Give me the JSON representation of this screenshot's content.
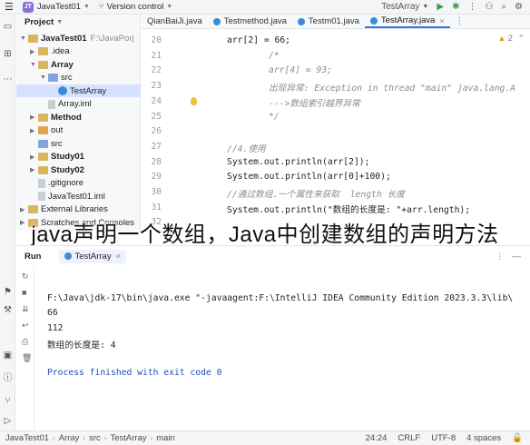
{
  "titlebar": {
    "project_badge": "JT",
    "project_name": "JavaTest01",
    "vcs_label": "Version control",
    "run_config": "TestArray"
  },
  "project_panel": {
    "title": "Project",
    "tree": [
      {
        "label": "JavaTest01",
        "suffix": "F:\\JavaPorj",
        "type": "folder",
        "depth": 0,
        "expanded": true
      },
      {
        "label": ".idea",
        "type": "folder",
        "depth": 1,
        "expanded": false
      },
      {
        "label": "Array",
        "type": "folder",
        "depth": 1,
        "expanded": true
      },
      {
        "label": "src",
        "type": "folder-blue",
        "depth": 2,
        "expanded": true
      },
      {
        "label": "TestArray",
        "type": "class",
        "depth": 3,
        "selected": true
      },
      {
        "label": "Array.iml",
        "type": "file",
        "depth": 2
      },
      {
        "label": "Method",
        "type": "folder",
        "depth": 1,
        "expanded": false
      },
      {
        "label": "out",
        "type": "folder-orange",
        "depth": 1,
        "expanded": false
      },
      {
        "label": "src",
        "type": "folder-blue",
        "depth": 1
      },
      {
        "label": "Study01",
        "type": "folder",
        "depth": 1,
        "expanded": false
      },
      {
        "label": "Study02",
        "type": "folder",
        "depth": 1,
        "expanded": false
      },
      {
        "label": ".gitignore",
        "type": "file",
        "depth": 1
      },
      {
        "label": "JavaTest01.iml",
        "type": "file",
        "depth": 1
      },
      {
        "label": "External Libraries",
        "type": "folder",
        "depth": 0,
        "expanded": false
      },
      {
        "label": "Scratches and Consoles",
        "type": "folder",
        "depth": 0,
        "expanded": false
      }
    ]
  },
  "tabs": [
    {
      "label": "QianBaiJi.java",
      "active": false
    },
    {
      "label": "Testmethod.java",
      "active": false
    },
    {
      "label": "Testm01.java",
      "active": false
    },
    {
      "label": "TestArray.java",
      "active": true
    }
  ],
  "editor": {
    "warnings": "2",
    "lines": [
      {
        "n": "20",
        "code": "arr[2] = 66;"
      },
      {
        "n": "21",
        "code": "/*"
      },
      {
        "n": "22",
        "code": "arr[4] = 93;"
      },
      {
        "n": "23",
        "code": "出现异常: Exception in thread \"main\" java.lang.A"
      },
      {
        "n": "24",
        "code": "--->数组索引越界异常"
      },
      {
        "n": "25",
        "code": "*/"
      },
      {
        "n": "26",
        "code": ""
      },
      {
        "n": "27",
        "code": "//4.使用"
      },
      {
        "n": "28",
        "code": "System.out.println(arr[2]);"
      },
      {
        "n": "29",
        "code": "System.out.println(arr[0]+100);"
      },
      {
        "n": "30",
        "code": "//通过数组.一个属性来获取  length 长度"
      },
      {
        "n": "31",
        "code": "System.out.println(\"数组的长度是: \"+arr.length);"
      },
      {
        "n": "32",
        "code": ""
      }
    ]
  },
  "caption": "java声明一个数组，Java中创建数组的声明方法",
  "run_panel": {
    "title": "Run",
    "tab_label": "TestArray",
    "output": [
      "F:\\Java\\jdk-17\\bin\\java.exe \"-javaagent:F:\\IntelliJ IDEA Community Edition 2023.3.3\\lib\\",
      "66",
      "112",
      "数组的长度是: 4",
      "",
      "Process finished with exit code 0"
    ]
  },
  "statusbar": {
    "breadcrumbs": [
      "JavaTest01",
      "Array",
      "src",
      "TestArray",
      "main"
    ],
    "position": "24:24",
    "line_sep": "CRLF",
    "encoding": "UTF-8",
    "indent": "4 spaces"
  },
  "colors": {
    "accent": "#3574f0",
    "string": "#067d17",
    "number": "#1750eb",
    "comment": "#8c8c8c",
    "field": "#871094",
    "console_info": "#1e4fbf"
  }
}
